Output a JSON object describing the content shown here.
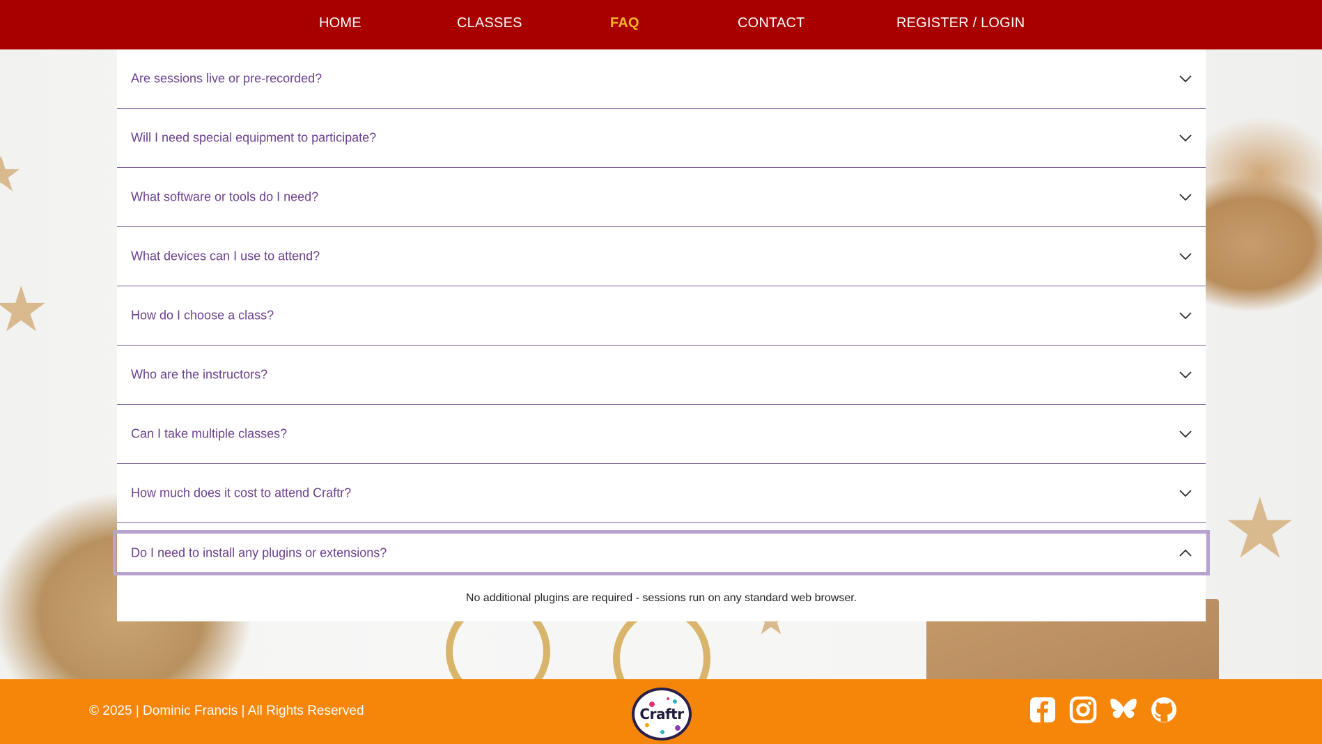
{
  "nav": {
    "items": [
      {
        "label": "HOME"
      },
      {
        "label": "CLASSES"
      },
      {
        "label": "FAQ",
        "active": true
      },
      {
        "label": "CONTACT"
      },
      {
        "label": "REGISTER / LOGIN"
      }
    ]
  },
  "faq": {
    "items": [
      {
        "question": "Are sessions live or pre-recorded?",
        "expanded": false
      },
      {
        "question": "Will I need special equipment to participate?",
        "expanded": false
      },
      {
        "question": "What software or tools do I need?",
        "expanded": false
      },
      {
        "question": "What devices can I use to attend?",
        "expanded": false
      },
      {
        "question": "How do I choose a class?",
        "expanded": false
      },
      {
        "question": "Who are the instructors?",
        "expanded": false
      },
      {
        "question": "Can I take multiple classes?",
        "expanded": false
      },
      {
        "question": "How much does it cost to attend Craftr?",
        "expanded": false
      },
      {
        "question": "Do I need to install any plugins or extensions?",
        "expanded": true,
        "answer": "No additional plugins are required - sessions run on any standard web browser."
      }
    ]
  },
  "footer": {
    "copyright": "© 2025 | Dominic Francis | All Rights Reserved",
    "logo_text": "Craftr",
    "social": [
      "facebook-icon",
      "instagram-icon",
      "bluesky-icon",
      "github-icon"
    ]
  },
  "colors": {
    "header_bg": "#a80000",
    "nav_active": "#f7b32b",
    "question_text": "#6b3f8e",
    "footer_bg": "#f5860a",
    "focus_outline": "#b8a2cf"
  }
}
